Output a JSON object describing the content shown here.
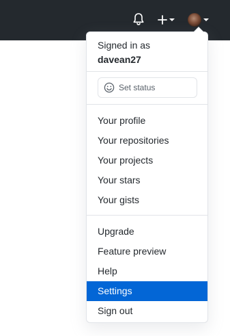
{
  "header": {
    "icons": [
      "bell-icon",
      "plus-icon",
      "chevron-down-icon",
      "avatar",
      "chevron-down-icon"
    ]
  },
  "dropdown": {
    "signed_in_label": "Signed in as",
    "username": "davean27",
    "status_button_label": "Set status",
    "status_icon": "smiley-icon",
    "group1": [
      {
        "label": "Your profile"
      },
      {
        "label": "Your repositories"
      },
      {
        "label": "Your projects"
      },
      {
        "label": "Your stars"
      },
      {
        "label": "Your gists"
      }
    ],
    "group2": [
      {
        "label": "Upgrade"
      },
      {
        "label": "Feature preview"
      },
      {
        "label": "Help"
      },
      {
        "label": "Settings",
        "active": true
      },
      {
        "label": "Sign out"
      }
    ]
  },
  "colors": {
    "header_bg": "#24292e",
    "active_bg": "#0366d6",
    "border": "#e1e4e8"
  }
}
